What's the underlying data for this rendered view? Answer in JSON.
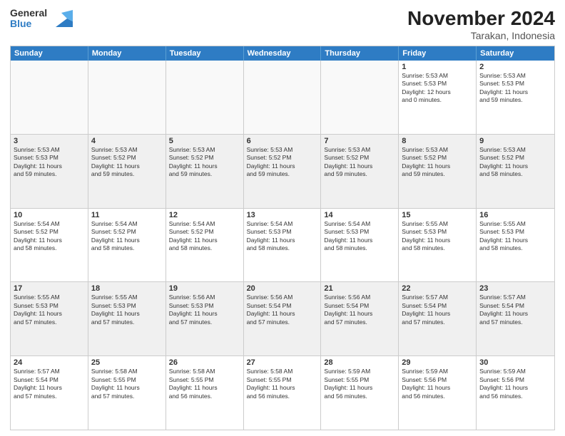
{
  "logo": {
    "line1": "General",
    "line2": "Blue"
  },
  "title": "November 2024",
  "subtitle": "Tarakan, Indonesia",
  "weekdays": [
    "Sunday",
    "Monday",
    "Tuesday",
    "Wednesday",
    "Thursday",
    "Friday",
    "Saturday"
  ],
  "weeks": [
    [
      {
        "day": "",
        "info": "",
        "empty": true
      },
      {
        "day": "",
        "info": "",
        "empty": true
      },
      {
        "day": "",
        "info": "",
        "empty": true
      },
      {
        "day": "",
        "info": "",
        "empty": true
      },
      {
        "day": "",
        "info": "",
        "empty": true
      },
      {
        "day": "1",
        "info": "Sunrise: 5:53 AM\nSunset: 5:53 PM\nDaylight: 12 hours\nand 0 minutes."
      },
      {
        "day": "2",
        "info": "Sunrise: 5:53 AM\nSunset: 5:53 PM\nDaylight: 11 hours\nand 59 minutes."
      }
    ],
    [
      {
        "day": "3",
        "info": "Sunrise: 5:53 AM\nSunset: 5:53 PM\nDaylight: 11 hours\nand 59 minutes."
      },
      {
        "day": "4",
        "info": "Sunrise: 5:53 AM\nSunset: 5:52 PM\nDaylight: 11 hours\nand 59 minutes."
      },
      {
        "day": "5",
        "info": "Sunrise: 5:53 AM\nSunset: 5:52 PM\nDaylight: 11 hours\nand 59 minutes."
      },
      {
        "day": "6",
        "info": "Sunrise: 5:53 AM\nSunset: 5:52 PM\nDaylight: 11 hours\nand 59 minutes."
      },
      {
        "day": "7",
        "info": "Sunrise: 5:53 AM\nSunset: 5:52 PM\nDaylight: 11 hours\nand 59 minutes."
      },
      {
        "day": "8",
        "info": "Sunrise: 5:53 AM\nSunset: 5:52 PM\nDaylight: 11 hours\nand 59 minutes."
      },
      {
        "day": "9",
        "info": "Sunrise: 5:53 AM\nSunset: 5:52 PM\nDaylight: 11 hours\nand 58 minutes."
      }
    ],
    [
      {
        "day": "10",
        "info": "Sunrise: 5:54 AM\nSunset: 5:52 PM\nDaylight: 11 hours\nand 58 minutes."
      },
      {
        "day": "11",
        "info": "Sunrise: 5:54 AM\nSunset: 5:52 PM\nDaylight: 11 hours\nand 58 minutes."
      },
      {
        "day": "12",
        "info": "Sunrise: 5:54 AM\nSunset: 5:52 PM\nDaylight: 11 hours\nand 58 minutes."
      },
      {
        "day": "13",
        "info": "Sunrise: 5:54 AM\nSunset: 5:53 PM\nDaylight: 11 hours\nand 58 minutes."
      },
      {
        "day": "14",
        "info": "Sunrise: 5:54 AM\nSunset: 5:53 PM\nDaylight: 11 hours\nand 58 minutes."
      },
      {
        "day": "15",
        "info": "Sunrise: 5:55 AM\nSunset: 5:53 PM\nDaylight: 11 hours\nand 58 minutes."
      },
      {
        "day": "16",
        "info": "Sunrise: 5:55 AM\nSunset: 5:53 PM\nDaylight: 11 hours\nand 58 minutes."
      }
    ],
    [
      {
        "day": "17",
        "info": "Sunrise: 5:55 AM\nSunset: 5:53 PM\nDaylight: 11 hours\nand 57 minutes."
      },
      {
        "day": "18",
        "info": "Sunrise: 5:55 AM\nSunset: 5:53 PM\nDaylight: 11 hours\nand 57 minutes."
      },
      {
        "day": "19",
        "info": "Sunrise: 5:56 AM\nSunset: 5:53 PM\nDaylight: 11 hours\nand 57 minutes."
      },
      {
        "day": "20",
        "info": "Sunrise: 5:56 AM\nSunset: 5:54 PM\nDaylight: 11 hours\nand 57 minutes."
      },
      {
        "day": "21",
        "info": "Sunrise: 5:56 AM\nSunset: 5:54 PM\nDaylight: 11 hours\nand 57 minutes."
      },
      {
        "day": "22",
        "info": "Sunrise: 5:57 AM\nSunset: 5:54 PM\nDaylight: 11 hours\nand 57 minutes."
      },
      {
        "day": "23",
        "info": "Sunrise: 5:57 AM\nSunset: 5:54 PM\nDaylight: 11 hours\nand 57 minutes."
      }
    ],
    [
      {
        "day": "24",
        "info": "Sunrise: 5:57 AM\nSunset: 5:54 PM\nDaylight: 11 hours\nand 57 minutes."
      },
      {
        "day": "25",
        "info": "Sunrise: 5:58 AM\nSunset: 5:55 PM\nDaylight: 11 hours\nand 57 minutes."
      },
      {
        "day": "26",
        "info": "Sunrise: 5:58 AM\nSunset: 5:55 PM\nDaylight: 11 hours\nand 56 minutes."
      },
      {
        "day": "27",
        "info": "Sunrise: 5:58 AM\nSunset: 5:55 PM\nDaylight: 11 hours\nand 56 minutes."
      },
      {
        "day": "28",
        "info": "Sunrise: 5:59 AM\nSunset: 5:55 PM\nDaylight: 11 hours\nand 56 minutes."
      },
      {
        "day": "29",
        "info": "Sunrise: 5:59 AM\nSunset: 5:56 PM\nDaylight: 11 hours\nand 56 minutes."
      },
      {
        "day": "30",
        "info": "Sunrise: 5:59 AM\nSunset: 5:56 PM\nDaylight: 11 hours\nand 56 minutes."
      }
    ]
  ]
}
